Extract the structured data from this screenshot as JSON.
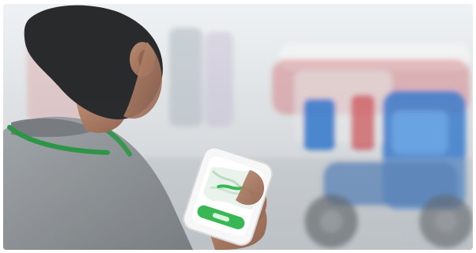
{
  "scene": {
    "kind": "photo",
    "subject": "person-using-smartphone",
    "background": "street-with-tuk-tuk",
    "accent_colors": {
      "app_green": "#2cb34a",
      "tuktuk_blue": "#2f74c9",
      "tuktuk_red": "#c8454a",
      "shirt_gray": "#8b8f93",
      "lanyard_green": "#1f8f3a"
    }
  },
  "phone": {
    "app_theme": "map-app",
    "screen_primary_color": "#2cb34a"
  }
}
